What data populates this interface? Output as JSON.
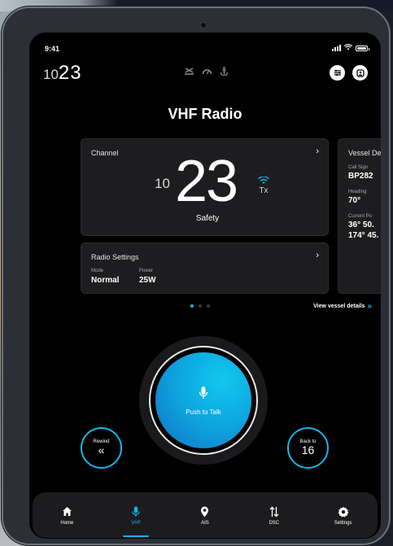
{
  "status_bar": {
    "time": "9:41"
  },
  "header": {
    "channel_prefix": "10",
    "channel_number": "23",
    "title": "VHF Radio"
  },
  "channel_card": {
    "title": "Channel",
    "prefix": "10",
    "number": "23",
    "description": "Safety",
    "tx_label": "Tx"
  },
  "radio_settings": {
    "title": "Radio Settings",
    "mode_label": "Mode",
    "mode_value": "Normal",
    "power_label": "Power",
    "power_value": "25W"
  },
  "vessel_card": {
    "title": "Vessel De",
    "call_sign_label": "Call Sign",
    "call_sign_value": "BP282",
    "heading_label": "Heading",
    "heading_value": "70°",
    "position_label": "Current Po",
    "position_lat": "36° 50.",
    "position_lon": "174° 45."
  },
  "pager": {
    "active_index": 0,
    "count": 3
  },
  "view_vessel_link": "View vessel details",
  "ptt": {
    "label": "Push to Talk"
  },
  "rewind": {
    "label": "Rewind"
  },
  "back_to": {
    "label": "Back to",
    "value": "16"
  },
  "nav": [
    {
      "label": "Home",
      "icon": "home-icon"
    },
    {
      "label": "VHF",
      "icon": "microphone-icon"
    },
    {
      "label": "AIS",
      "icon": "location-pin-icon"
    },
    {
      "label": "DSC",
      "icon": "swap-arrows-icon"
    },
    {
      "label": "Settings",
      "icon": "gear-icon"
    }
  ],
  "colors": {
    "accent": "#11b6e8",
    "background": "#000000",
    "card": "#1d1d1f"
  }
}
